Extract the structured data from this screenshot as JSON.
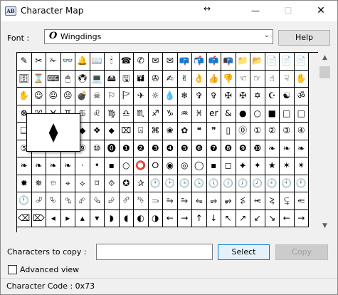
{
  "window": {
    "title": "Character Map",
    "app_icon_text": "AB"
  },
  "titlebar": {
    "move_icon": "↔",
    "minimize": "—",
    "maximize": "☐",
    "close": "✕"
  },
  "font": {
    "label": "Font :",
    "type_icon": "O",
    "value": "Wingdings",
    "chevron": "⌄"
  },
  "buttons": {
    "help": "Help",
    "select": "Select",
    "copy": "Copy"
  },
  "grid": {
    "rows": [
      [
        "✎",
        "✂",
        "✁",
        "👓",
        "🔔",
        "📖",
        "🕯",
        "☎",
        "✆",
        "✉",
        "✉",
        "📪",
        "📬",
        "📫",
        "📭",
        "📁",
        "📂",
        "📄",
        "📄",
        "📄"
      ],
      [
        "🗄",
        "⌛",
        "⌨",
        "🖱",
        "🖲",
        "💻",
        "🖴",
        "🖫",
        "🖬",
        "✇",
        "✍",
        "✌",
        "👌",
        "👍",
        "👎",
        "☜",
        "☞",
        "☝",
        "☟",
        "✋"
      ],
      [
        "✋",
        "☺",
        "😐",
        "☹",
        "💣",
        "☠",
        "⚐",
        "🏱",
        "✈",
        "☼",
        "💧",
        "❄",
        "✞",
        "✞",
        "✠",
        "✠",
        "✡",
        "☪",
        "☯",
        "ॐ"
      ],
      [
        "☸",
        "♈",
        "♉",
        "♊",
        "♋",
        "♌",
        "♍",
        "♎",
        "♏",
        "♐",
        "♑",
        "♒",
        "♓",
        "er",
        "&",
        "●",
        "○",
        "■",
        "□",
        "□"
      ],
      [
        "❑",
        "❒",
        "⬧",
        "⧫",
        "◆",
        "❖",
        "⬥",
        "⌧",
        "⍓",
        "⌘",
        "❀",
        "✿",
        "❝",
        "❞",
        "▯",
        "⓪",
        "①",
        "②",
        "③",
        "④"
      ],
      [
        "⑤",
        "⑥",
        "⑦",
        "⑧",
        "⑨",
        "⑩",
        "⓿",
        "❶",
        "❷",
        "❸",
        "❹",
        "❺",
        "❻",
        "❼",
        "❽",
        "❾",
        "❿",
        "❧",
        "❧",
        "❧"
      ],
      [
        "❧",
        "❧",
        "❧",
        "❧",
        "·",
        "•",
        "▪",
        "○",
        "⭕",
        "⭘",
        "◉",
        "◎",
        "◯",
        "▪",
        "◻",
        "⯌",
        "✦",
        "★",
        "✶",
        "✴"
      ],
      [
        "✹",
        "✵",
        "⯐",
        "⌖",
        "⟡",
        "⌑",
        "⯑",
        "✪",
        "✰",
        "🕐",
        "🕑",
        "🕒",
        "🕓",
        "🕔",
        "🕕",
        "🕖",
        "🕗",
        "🕘",
        "🕙",
        "🕚"
      ],
      [
        "🕛",
        "⮰",
        "⮱",
        "⮲",
        "⮳",
        "⮴",
        "⮵",
        "⮶",
        "⮷",
        "⥰",
        "⥱",
        "⥲",
        "⥳",
        "⥴",
        "⥵",
        "⥶",
        "⥷",
        "⥸",
        "⥹",
        "⥺"
      ],
      [
        "⌫",
        "⌦",
        "◂",
        "▸",
        "▴",
        "▾",
        "◗",
        "◖",
        "◐",
        "◑",
        "←",
        "→",
        "↑",
        "↓",
        "↖",
        "↗",
        "↙",
        "↘",
        "←",
        "→"
      ]
    ]
  },
  "zoom": {
    "glyph": "⧫"
  },
  "scrollbar": {
    "up": "▲",
    "down": "▼"
  },
  "copy": {
    "label": "Characters to copy :",
    "value": ""
  },
  "advanced_view": {
    "label": "Advanced view",
    "checked": false
  },
  "status": {
    "text": "Character Code : 0x73"
  }
}
